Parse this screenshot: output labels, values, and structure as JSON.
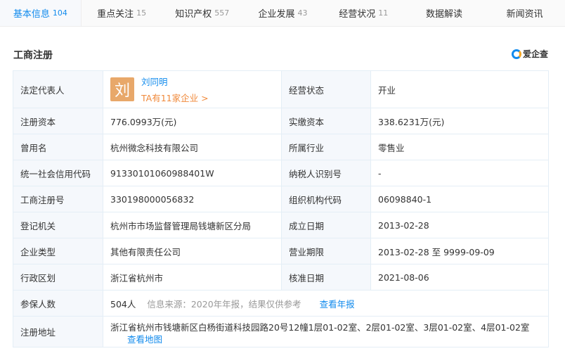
{
  "tabs": [
    {
      "label": "基本信息",
      "count": "104"
    },
    {
      "label": "重点关注",
      "count": "15"
    },
    {
      "label": "知识产权",
      "count": "557"
    },
    {
      "label": "企业发展",
      "count": "43"
    },
    {
      "label": "经营状况",
      "count": "11"
    },
    {
      "label": "数据解读",
      "count": ""
    },
    {
      "label": "新闻资讯",
      "count": ""
    }
  ],
  "section_title": "工商注册",
  "logo_text": "爱企查",
  "legal_rep": {
    "label": "法定代表人",
    "avatar_char": "刘",
    "name": "刘同明",
    "companies": "TA有11家企业 >"
  },
  "status": {
    "label": "经营状态",
    "value": "开业"
  },
  "rows": [
    [
      "注册资本",
      "776.0993万(元)",
      "实缴资本",
      "338.6231万(元)"
    ],
    [
      "曾用名",
      "杭州微念科技有限公司",
      "所属行业",
      "零售业"
    ],
    [
      "统一社会信用代码",
      "91330101060988401W",
      "纳税人识别号",
      "-"
    ],
    [
      "工商注册号",
      "330198000056832",
      "组织机构代码",
      "06098840-1"
    ],
    [
      "登记机关",
      "杭州市市场监督管理局钱塘新区分局",
      "成立日期",
      "2013-02-28"
    ],
    [
      "企业类型",
      "其他有限责任公司",
      "营业期限",
      "2013-02-28 至 9999-09-09"
    ],
    [
      "行政区划",
      "浙江省杭州市",
      "核准日期",
      "2021-08-06"
    ]
  ],
  "insured": {
    "label": "参保人数",
    "value": "504人",
    "source": "信息来源：2020年年报，结果仅供参考",
    "link": "查看年报"
  },
  "address": {
    "label": "注册地址",
    "value": "浙江省杭州市钱塘新区白杨街道科技园路20号12幢1层01-02室、2层01-02室、3层01-02室、4层01-02室",
    "link": "查看地图"
  }
}
